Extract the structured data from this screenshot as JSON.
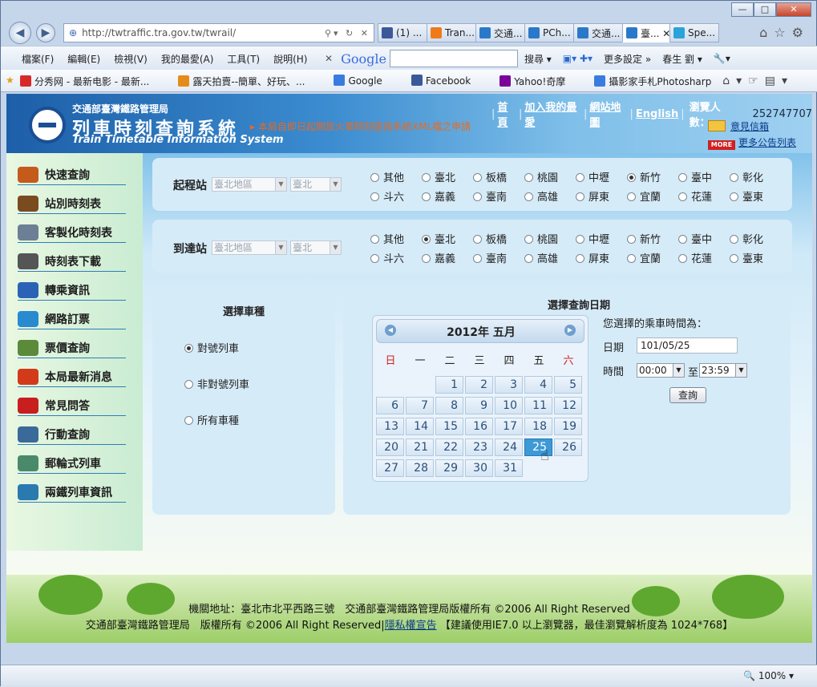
{
  "browser": {
    "url": "http://twtraffic.tra.gov.tw/twrail/",
    "tabs": [
      {
        "label": "(1) ...",
        "color": "#3b5998"
      },
      {
        "label": "Tran...",
        "color": "#f07a1a"
      },
      {
        "label": "交通...",
        "color": "#2a79c9"
      },
      {
        "label": "PCh...",
        "color": "#2a79c9"
      },
      {
        "label": "交通...",
        "color": "#2a79c9"
      },
      {
        "label": "臺... ✕",
        "color": "#2a79c9"
      },
      {
        "label": "Spe...",
        "color": "#2aa3d9"
      }
    ],
    "menu": [
      "檔案(F)",
      "編輯(E)",
      "檢視(V)",
      "我的最愛(A)",
      "工具(T)",
      "說明(H)"
    ],
    "google_logo": "Google",
    "google_items": [
      "搜尋 ▾",
      "更多設定 »",
      "春生 劉 ▾"
    ],
    "favorites": [
      {
        "label": "分秀网 - 最新电影 - 最新...",
        "color": "#d62a2a"
      },
      {
        "label": "露天拍賣--簡單、好玩、...",
        "color": "#e58b19"
      },
      {
        "label": "Google",
        "color": "#3a7be0"
      },
      {
        "label": "Facebook",
        "color": "#3b5998"
      },
      {
        "label": "Yahoo!奇摩",
        "color": "#7b0099"
      },
      {
        "label": "攝影家手札Photosharp",
        "color": "#3a7be0"
      }
    ],
    "zoom": "100%"
  },
  "header": {
    "agency": "交通部臺灣鐵路管理局",
    "title": "列車時刻查詢系統",
    "title_en": "Train Timetable Information System",
    "marquee": "本局自即日起開放火車時刻查詢系統XML檔之申請",
    "links": [
      "首頁",
      "加入我的最愛",
      "網站地圖",
      "English"
    ],
    "visitor_label": "瀏覽人數：",
    "visitor_count": "252747707",
    "mailbox": "意見信箱",
    "more_badge": "MORE",
    "more_notices": "更多公告列表"
  },
  "sidebar": [
    {
      "label": "快速查詢",
      "color": "#c45b1a"
    },
    {
      "label": "站別時刻表",
      "color": "#7a4b1e"
    },
    {
      "label": "客製化時刻表",
      "color": "#6d7f94"
    },
    {
      "label": "時刻表下載",
      "color": "#555"
    },
    {
      "label": "轉乘資訊",
      "color": "#2a63b5"
    },
    {
      "label": "網路訂票",
      "color": "#2a8ad0"
    },
    {
      "label": "票價查詢",
      "color": "#5a8a3a"
    },
    {
      "label": "本局最新消息",
      "color": "#d23a1a"
    },
    {
      "label": "常見問答",
      "color": "#c81e1e"
    },
    {
      "label": "行動查詢",
      "color": "#3a6a9a"
    },
    {
      "label": "郵輪式列車",
      "color": "#4a8a6a"
    },
    {
      "label": "兩鐵列車資訊",
      "color": "#2a7ab0"
    }
  ],
  "departure": {
    "label": "起程站",
    "region": "臺北地區",
    "station": "臺北",
    "options": [
      "其他",
      "臺北",
      "板橋",
      "桃園",
      "中壢",
      "新竹",
      "臺中",
      "彰化",
      "斗六",
      "嘉義",
      "臺南",
      "高雄",
      "屏東",
      "宜蘭",
      "花蓮",
      "臺東"
    ],
    "selected": "新竹"
  },
  "arrival": {
    "label": "到達站",
    "region": "臺北地區",
    "station": "臺北",
    "options": [
      "其他",
      "臺北",
      "板橋",
      "桃園",
      "中壢",
      "新竹",
      "臺中",
      "彰化",
      "斗六",
      "嘉義",
      "臺南",
      "高雄",
      "屏東",
      "宜蘭",
      "花蓮",
      "臺東"
    ],
    "selected": "臺北"
  },
  "train_type": {
    "title": "選擇車種",
    "options": [
      "對號列車",
      "非對號列車",
      "所有車種"
    ],
    "selected": "對號列車"
  },
  "date_panel": {
    "title": "選擇查詢日期",
    "calendar_title": "2012年 五月",
    "weekdays": [
      "日",
      "一",
      "二",
      "三",
      "四",
      "五",
      "六"
    ],
    "weekend_color": "#d21e1e",
    "first_weekday": 2,
    "days_in_month": 31,
    "selected_day": 25,
    "chosen_label": "您選擇的乘車時間為：",
    "date_label": "日期",
    "date_value": "101/05/25",
    "time_label": "時間",
    "time_from": "00:00",
    "time_to_label": "至",
    "time_to": "23:59",
    "query_button": "查詢"
  },
  "footer": {
    "line1": "機關地址：臺北市北平西路三號　交通部臺灣鐵路管理局版權所有 ©2006 All Right Reserved",
    "line2a": "交通部臺灣鐵路管理局　版權所有 ©2006 All Right Reserved",
    "privacy": "隱私權宣告",
    "line2b": "【建議使用IE7.0 以上瀏覽器，最佳瀏覽解析度為 1024*768】"
  }
}
